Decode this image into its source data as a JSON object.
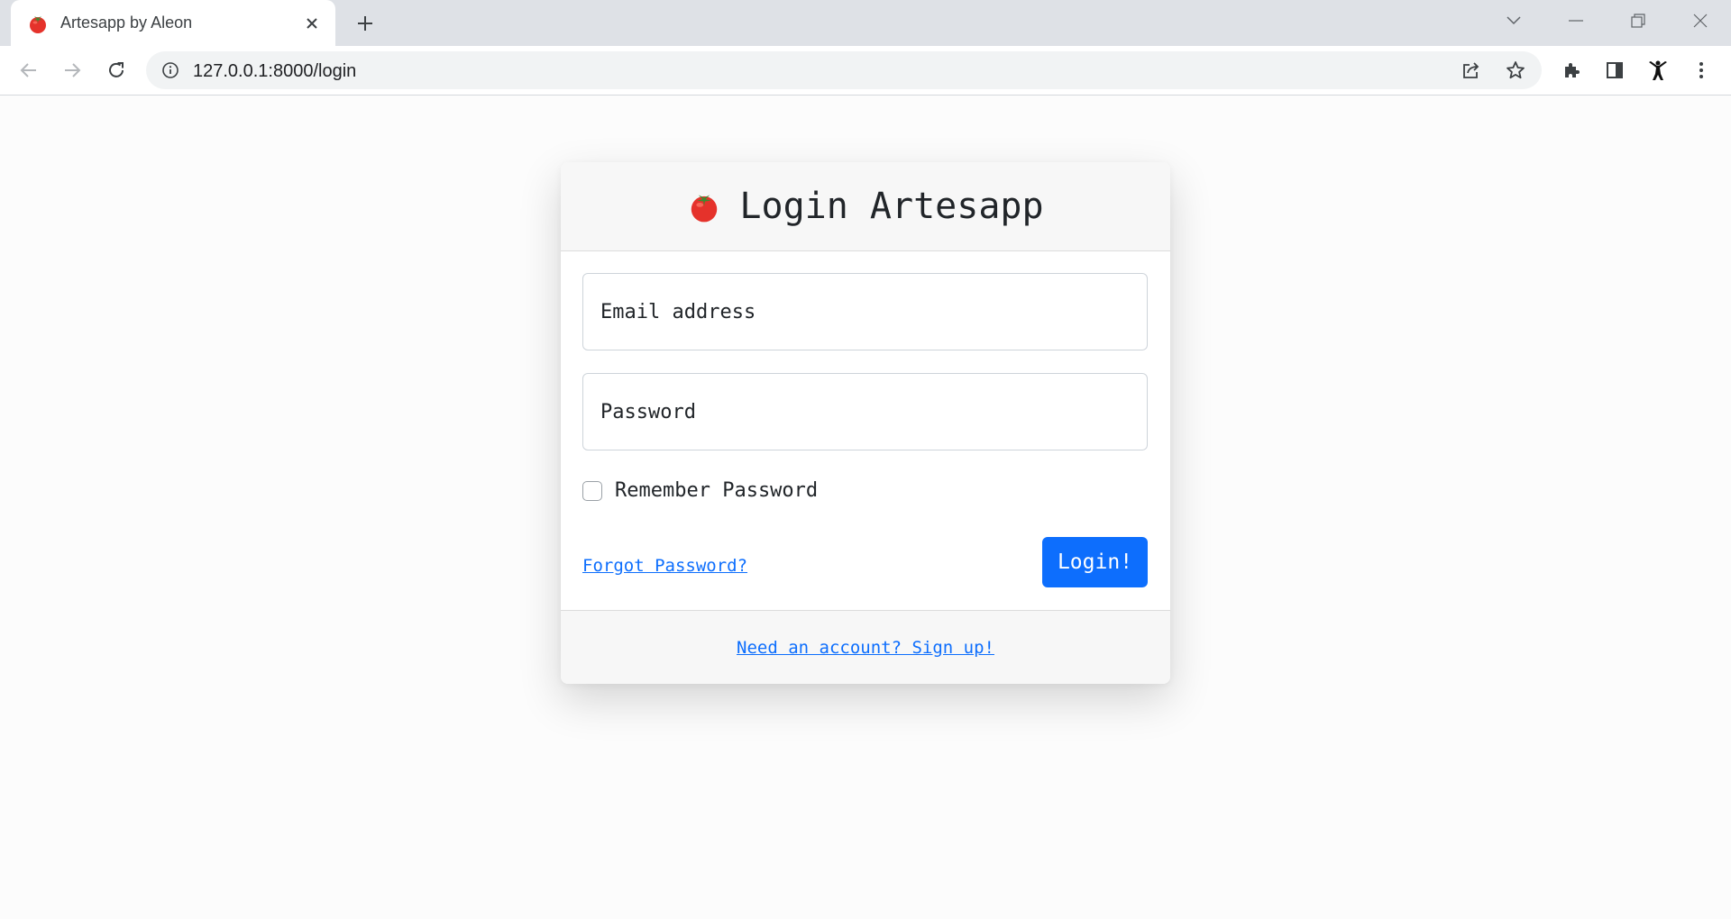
{
  "browser": {
    "tab_title": "Artesapp by Aleon",
    "url": "127.0.0.1:8000/login",
    "colors": {
      "tabstrip": "#dee1e6",
      "toolbar": "#ffffff",
      "omnibox": "#f1f3f4"
    }
  },
  "login": {
    "title": "Login Artesapp",
    "logo_icon": "tomato-icon",
    "email_label": "Email address",
    "password_label": "Password",
    "remember_label": "Remember Password",
    "remember_checked": false,
    "forgot_link": "Forgot Password?",
    "login_button": "Login!",
    "signup_link": "Need an account? Sign up!",
    "colors": {
      "accent": "#0d6efd",
      "header_bg": "#f7f7f7",
      "page_bg": "#fcfcfc"
    }
  }
}
